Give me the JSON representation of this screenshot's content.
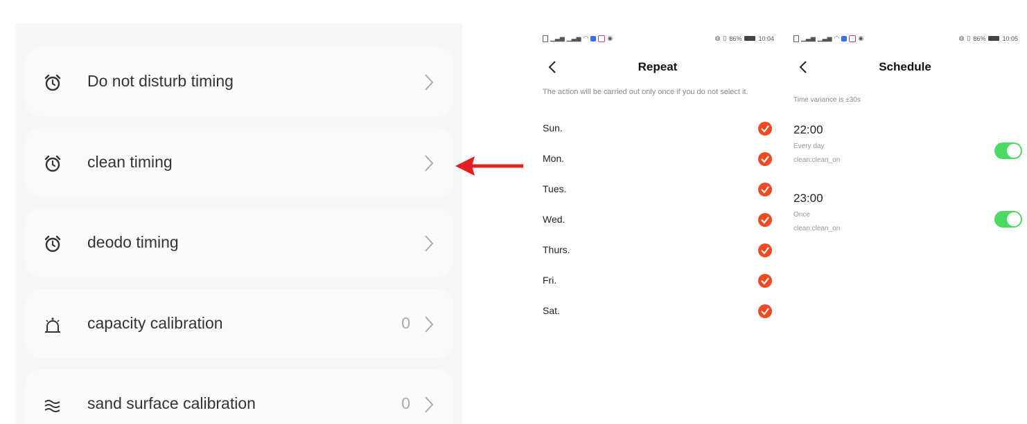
{
  "settings": {
    "items": [
      {
        "icon": "alarm-clock-icon",
        "label": "Do not disturb timing",
        "value": ""
      },
      {
        "icon": "alarm-clock-icon",
        "label": "clean timing",
        "value": ""
      },
      {
        "icon": "alarm-clock-icon",
        "label": "deodo timing",
        "value": ""
      },
      {
        "icon": "bell-icon",
        "label": "capacity calibration",
        "value": "0"
      },
      {
        "icon": "waves-icon",
        "label": "sand surface calibration",
        "value": "0"
      }
    ]
  },
  "repeat_screen": {
    "status_time": "10:04",
    "battery": "86%",
    "title": "Repeat",
    "note": "The action will be carried out only once if you do not select it.",
    "days": [
      "Sun.",
      "Mon.",
      "Tues.",
      "Wed.",
      "Thurs.",
      "Fri.",
      "Sat."
    ],
    "check_color": "#f04a23"
  },
  "schedule_screen": {
    "status_time": "10:05",
    "battery": "86%",
    "title": "Schedule",
    "note": "Time variance is ±30s",
    "entries": [
      {
        "time": "22:00",
        "repeat": "Every day",
        "action": "clean:clean_on",
        "enabled": true
      },
      {
        "time": "23:00",
        "repeat": "Once",
        "action": "clean:clean_on",
        "enabled": true
      }
    ],
    "toggle_color": "#4cd964"
  },
  "arrow_color": "#e02020"
}
